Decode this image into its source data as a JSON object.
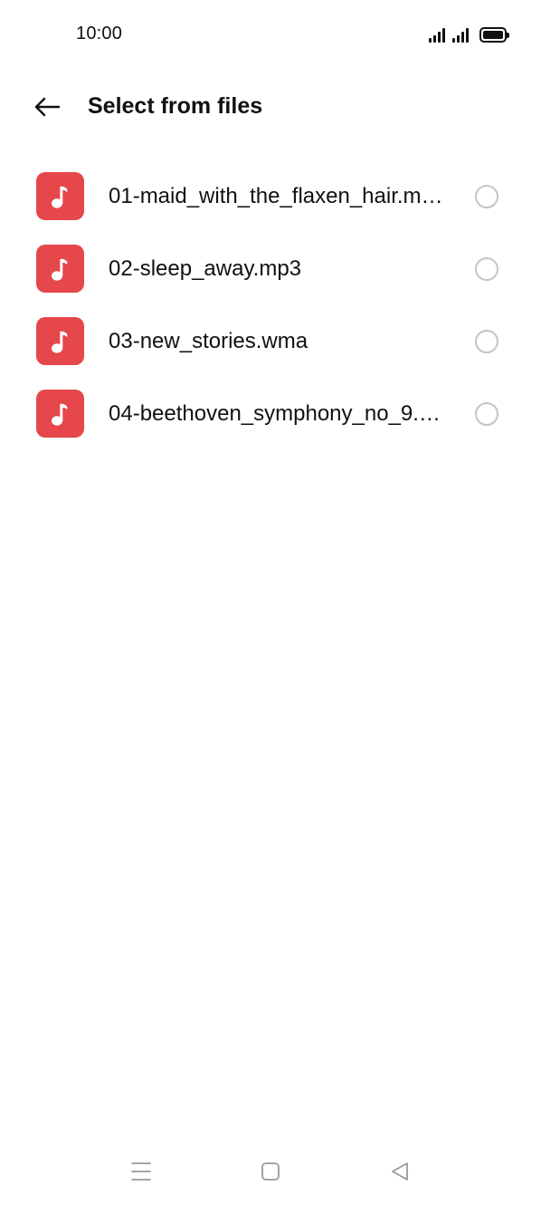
{
  "status_bar": {
    "time": "10:00",
    "signal_icons": [
      "signal-strength-icon",
      "signal-strength-icon"
    ],
    "battery_icon": "battery-full-icon"
  },
  "header": {
    "back_icon": "arrow-left-icon",
    "title": "Select from files"
  },
  "colors": {
    "file_icon_bg": "#e5474a",
    "radio_border": "#c4c4c4",
    "text": "#111111"
  },
  "files": [
    {
      "name": "01-maid_with_the_flaxen_hair.m…",
      "icon": "music-note-icon",
      "selected": false
    },
    {
      "name": "02-sleep_away.mp3",
      "icon": "music-note-icon",
      "selected": false
    },
    {
      "name": "03-new_stories.wma",
      "icon": "music-note-icon",
      "selected": false
    },
    {
      "name": "04-beethoven_symphony_no_9.…",
      "icon": "music-note-icon",
      "selected": false
    }
  ],
  "nav_bar": {
    "menu_icon": "menu-icon",
    "home_icon": "home-square-icon",
    "back_icon": "back-triangle-icon"
  }
}
